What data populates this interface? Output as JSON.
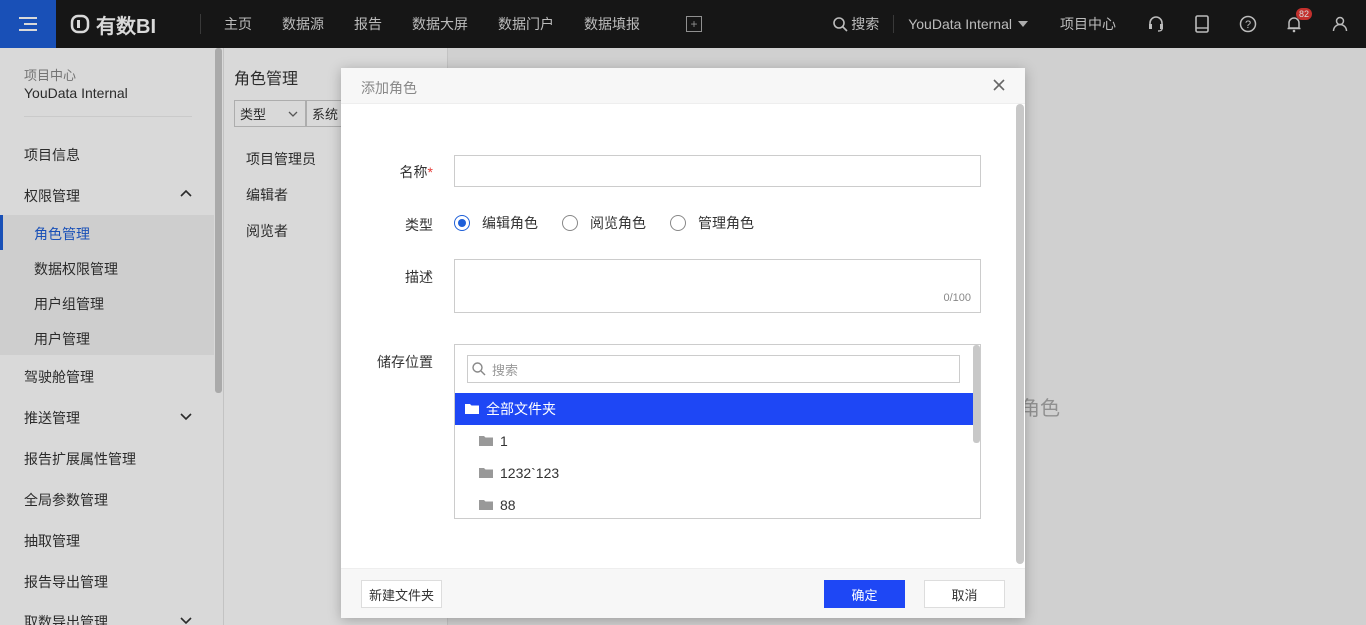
{
  "topnav": {
    "brand": "有数BI",
    "items": [
      "主页",
      "数据源",
      "报告",
      "数据大屏",
      "数据门户",
      "数据填报"
    ],
    "search_label": "搜索",
    "project": "YouData Internal",
    "project_center": "项目中心",
    "notification_count": "82"
  },
  "sidebar": {
    "project_label": "项目中心",
    "project_name": "YouData Internal",
    "items": {
      "project_info": "项目信息",
      "permission": "权限管理",
      "role": "角色管理",
      "data_permission": "数据权限管理",
      "user_group": "用户组管理",
      "user": "用户管理",
      "cockpit": "驾驶舱管理",
      "push": "推送管理",
      "report_ext": "报告扩展属性管理",
      "global_param": "全局参数管理",
      "extract": "抽取管理",
      "report_export": "报告导出管理",
      "data_export": "取数导出管理"
    }
  },
  "role_panel": {
    "title": "角色管理",
    "filter_type": "类型",
    "filter_system": "系统",
    "roles": [
      "项目管理员",
      "编辑者",
      "阅览者"
    ]
  },
  "background_hint": "角色",
  "modal": {
    "title": "添加角色",
    "name_label": "名称",
    "name_value": "",
    "type_label": "类型",
    "type_options": [
      "编辑角色",
      "阅览角色",
      "管理角色"
    ],
    "type_selected": "编辑角色",
    "desc_label": "描述",
    "desc_count": "0/100",
    "storage_label": "储存位置",
    "tree_search_placeholder": "搜索",
    "tree": {
      "root": "全部文件夹",
      "children": [
        "1",
        "1232`123",
        "88"
      ]
    },
    "new_folder_label": "新建文件夹",
    "ok_label": "确定",
    "cancel_label": "取消"
  },
  "colors": {
    "accent": "#1e5fd8",
    "selected_row": "#1e47f5",
    "topnav_bg": "#1a1a1a"
  }
}
